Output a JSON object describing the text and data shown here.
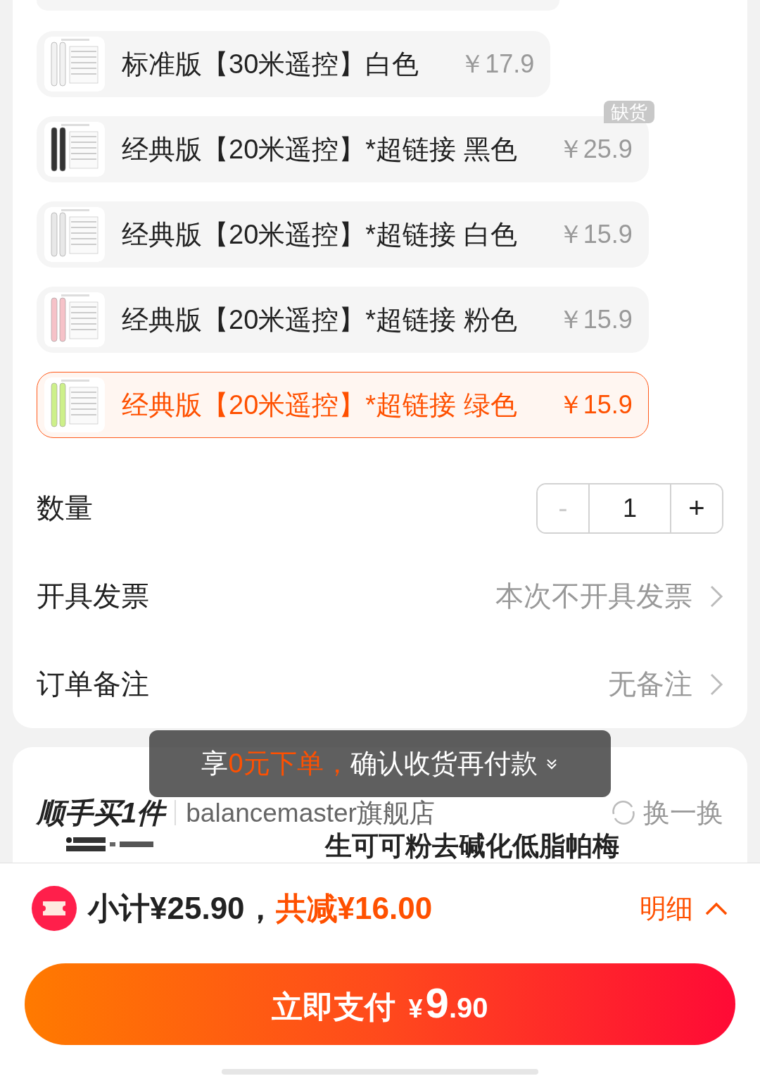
{
  "options": [
    {
      "label": "标准版【30米遥控】白色",
      "price": "￥17.9",
      "selected": false
    },
    {
      "label": "经典版【20米遥控】*超链接 黑色",
      "price": "￥25.9",
      "selected": false,
      "badge": "缺货"
    },
    {
      "label": "经典版【20米遥控】*超链接 白色",
      "price": "￥15.9",
      "selected": false
    },
    {
      "label": "经典版【20米遥控】*超链接 粉色",
      "price": "￥15.9",
      "selected": false
    },
    {
      "label": "经典版【20米遥控】*超链接 绿色",
      "price": "￥15.9",
      "selected": true
    }
  ],
  "quantity": {
    "label": "数量",
    "value": "1",
    "minus": "-",
    "plus": "+",
    "minus_disabled": true
  },
  "settings": [
    {
      "label": "开具发票",
      "value": "本次不开具发票"
    },
    {
      "label": "订单备注",
      "value": "无备注"
    }
  ],
  "toast": {
    "prefix": "享",
    "highlight": "0元下单，",
    "suffix": "确认收货再付款"
  },
  "addon": {
    "title": "顺手买1件",
    "store": "balancemaster旗舰店",
    "refresh": "换一换",
    "product_title": "生可可粉去碱化低脂帕梅"
  },
  "summary": {
    "subtotal": "小计¥25.90，",
    "discount": "共减¥16.00",
    "details": "明细",
    "details_expanded": true
  },
  "pay_button": {
    "label": "立即支付",
    "currency": "¥",
    "price_main": "9",
    "price_cents": ".90"
  }
}
